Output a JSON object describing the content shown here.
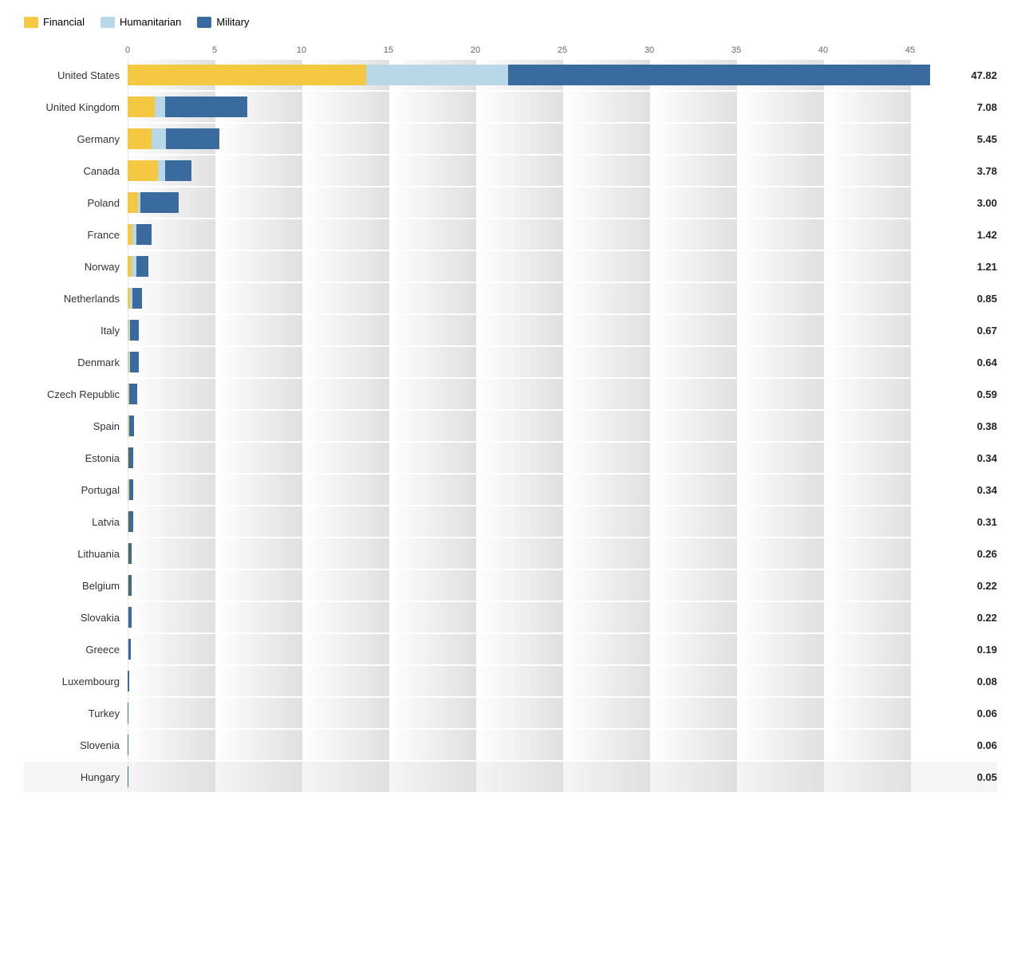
{
  "legend": {
    "items": [
      {
        "label": "Financial",
        "color": "#F5C842",
        "name": "financial"
      },
      {
        "label": "Humanitarian",
        "color": "#B8D8E8",
        "name": "humanitarian"
      },
      {
        "label": "Military",
        "color": "#3A6B9F",
        "name": "military"
      }
    ]
  },
  "axis": {
    "ticks": [
      0,
      5,
      10,
      15,
      20,
      25,
      30,
      35,
      40,
      45
    ],
    "max": 50
  },
  "countries": [
    {
      "name": "United States",
      "total": 47.82,
      "financial": 14.2,
      "humanitarian": 8.5,
      "military": 25.12
    },
    {
      "name": "United Kingdom",
      "total": 7.08,
      "financial": 1.6,
      "humanitarian": 0.6,
      "military": 4.88
    },
    {
      "name": "Germany",
      "total": 5.45,
      "financial": 1.4,
      "humanitarian": 0.85,
      "military": 3.2
    },
    {
      "name": "Canada",
      "total": 3.78,
      "financial": 1.8,
      "humanitarian": 0.4,
      "military": 1.58
    },
    {
      "name": "Poland",
      "total": 3.0,
      "financial": 0.6,
      "humanitarian": 0.15,
      "military": 2.25
    },
    {
      "name": "France",
      "total": 1.42,
      "financial": 0.28,
      "humanitarian": 0.25,
      "military": 0.89
    },
    {
      "name": "Norway",
      "total": 1.21,
      "financial": 0.22,
      "humanitarian": 0.32,
      "military": 0.67
    },
    {
      "name": "Netherlands",
      "total": 0.85,
      "financial": 0.12,
      "humanitarian": 0.18,
      "military": 0.55
    },
    {
      "name": "Italy",
      "total": 0.67,
      "financial": 0.05,
      "humanitarian": 0.08,
      "military": 0.54
    },
    {
      "name": "Denmark",
      "total": 0.64,
      "financial": 0.06,
      "humanitarian": 0.07,
      "military": 0.51
    },
    {
      "name": "Czech Republic",
      "total": 0.59,
      "financial": 0.04,
      "humanitarian": 0.06,
      "military": 0.49
    },
    {
      "name": "Spain",
      "total": 0.38,
      "financial": 0.05,
      "humanitarian": 0.05,
      "military": 0.28
    },
    {
      "name": "Estonia",
      "total": 0.34,
      "financial": 0.03,
      "humanitarian": 0.03,
      "military": 0.28
    },
    {
      "name": "Portugal",
      "total": 0.34,
      "financial": 0.04,
      "humanitarian": 0.04,
      "military": 0.26
    },
    {
      "name": "Latvia",
      "total": 0.31,
      "financial": 0.03,
      "humanitarian": 0.03,
      "military": 0.25
    },
    {
      "name": "Lithuania",
      "total": 0.26,
      "financial": 0.03,
      "humanitarian": 0.02,
      "military": 0.21
    },
    {
      "name": "Belgium",
      "total": 0.22,
      "financial": 0.03,
      "humanitarian": 0.03,
      "military": 0.16
    },
    {
      "name": "Slovakia",
      "total": 0.22,
      "financial": 0.02,
      "humanitarian": 0.02,
      "military": 0.18
    },
    {
      "name": "Greece",
      "total": 0.19,
      "financial": 0.02,
      "humanitarian": 0.02,
      "military": 0.15
    },
    {
      "name": "Luxembourg",
      "total": 0.08,
      "financial": 0.01,
      "humanitarian": 0.01,
      "military": 0.06
    },
    {
      "name": "Turkey",
      "total": 0.06,
      "financial": 0.01,
      "humanitarian": 0.01,
      "military": 0.04
    },
    {
      "name": "Slovenia",
      "total": 0.06,
      "financial": 0.01,
      "humanitarian": 0.01,
      "military": 0.04
    },
    {
      "name": "Hungary",
      "total": 0.05,
      "financial": 0.01,
      "humanitarian": 0.01,
      "military": 0.03
    }
  ],
  "colors": {
    "financial": "#F5C842",
    "humanitarian": "#B8D8E8",
    "military": "#3A6B9F"
  }
}
